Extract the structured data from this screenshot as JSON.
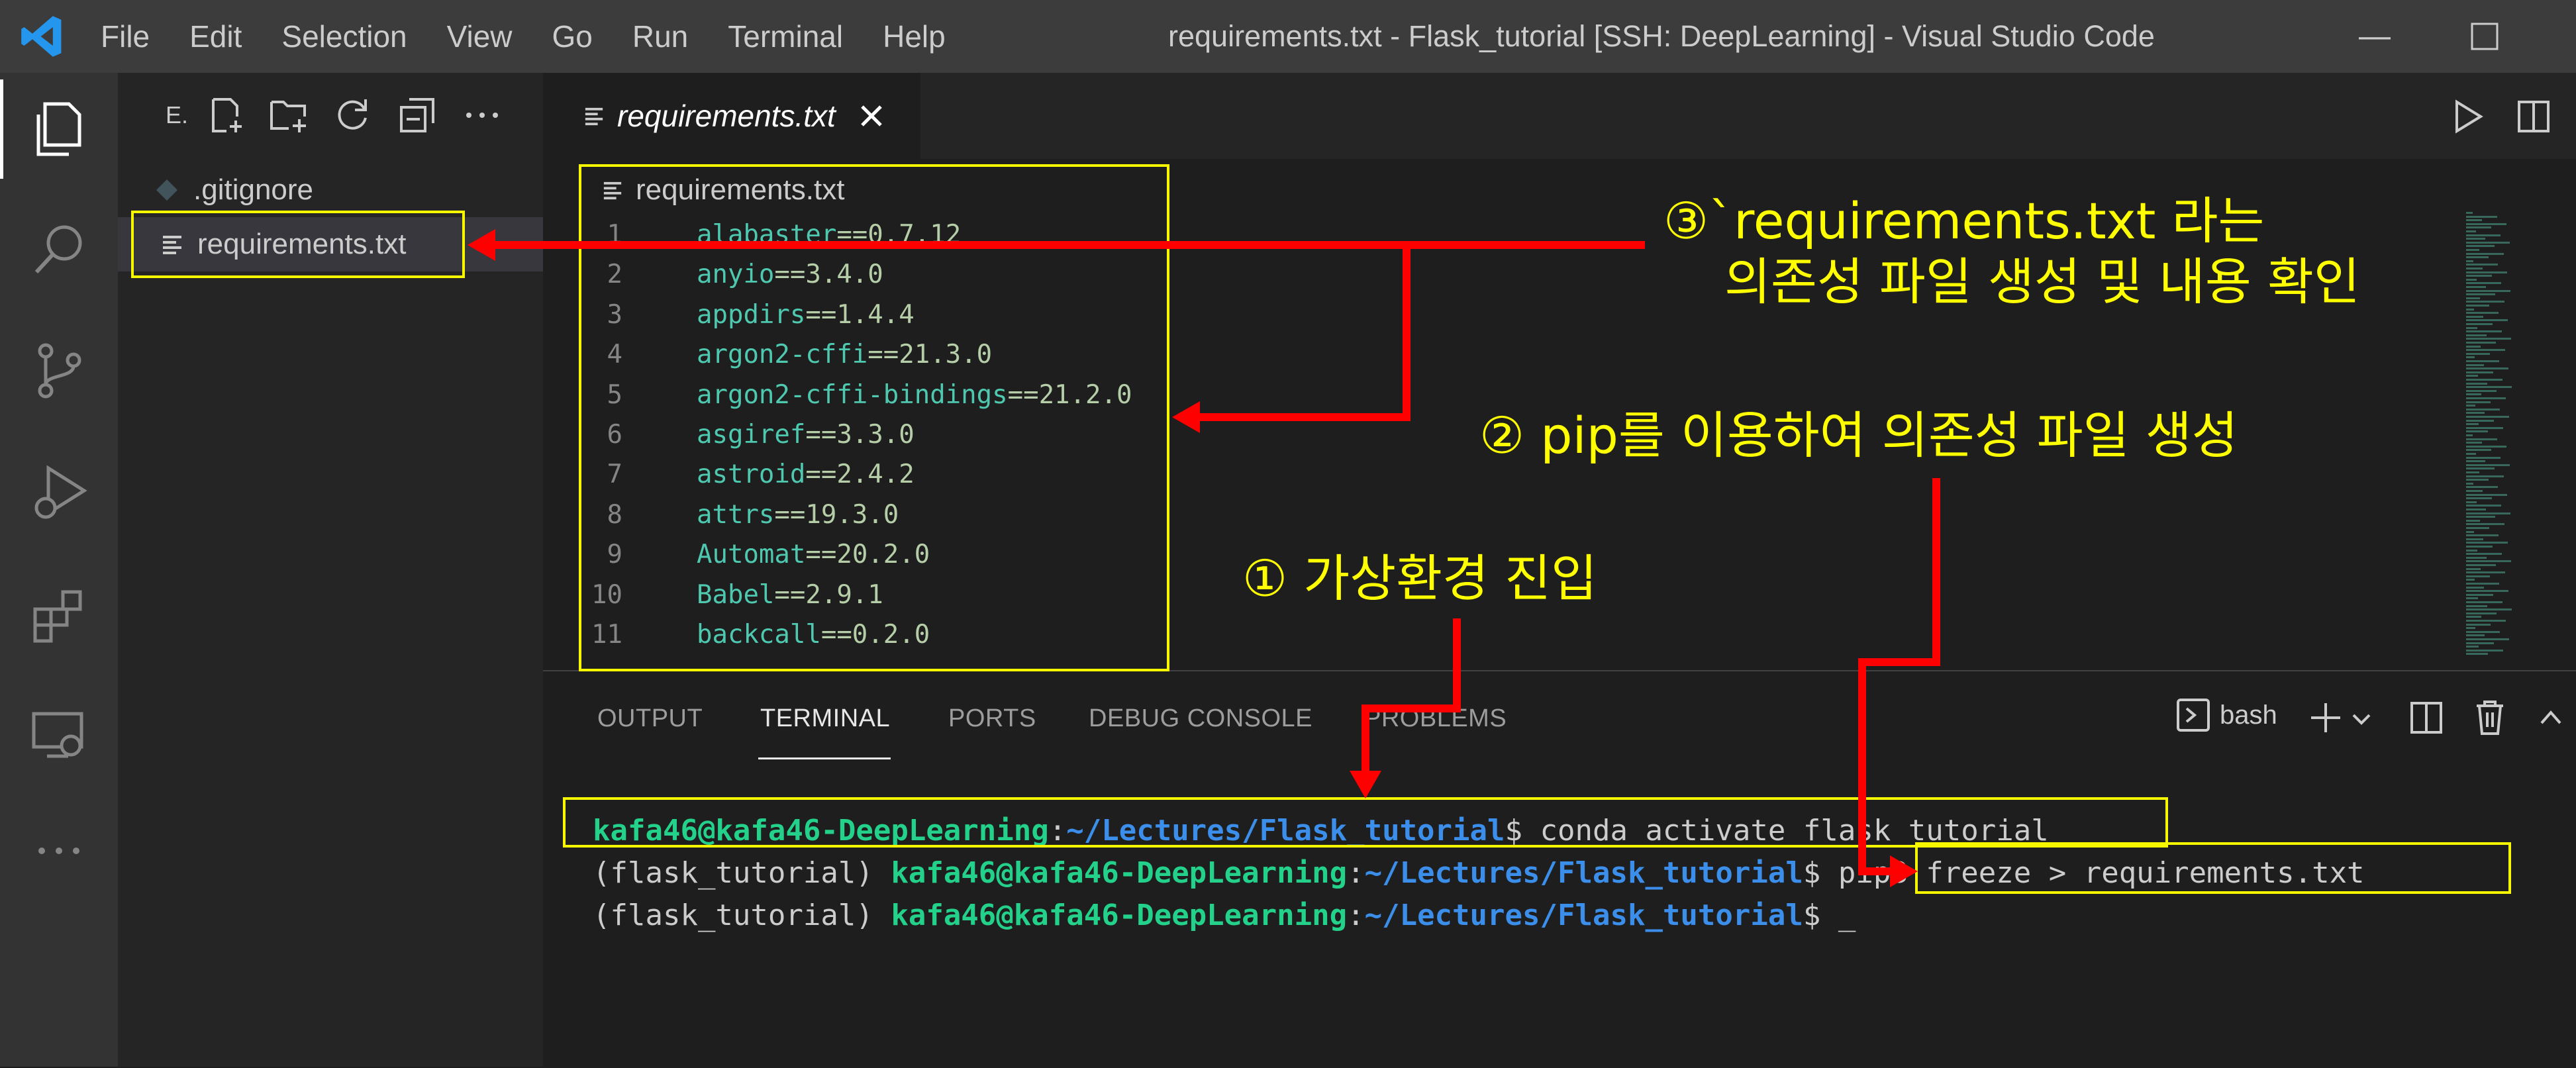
{
  "window": {
    "title": "requirements.txt - Flask_tutorial [SSH: DeepLearning] - Visual Studio Code",
    "menu": [
      "File",
      "Edit",
      "Selection",
      "View",
      "Go",
      "Run",
      "Terminal",
      "Help"
    ]
  },
  "activity_bar": {
    "icons": [
      "explorer-icon",
      "search-icon",
      "source-control-icon",
      "run-debug-icon",
      "extensions-icon",
      "remote-explorer-icon",
      "more-icon"
    ]
  },
  "sidebar": {
    "header": "E.",
    "toolbar_icons": [
      "new-file-icon",
      "new-folder-icon",
      "refresh-icon",
      "collapse-all-icon",
      "more-icon"
    ],
    "files": [
      {
        "name": ".gitignore",
        "icon": "gitignore-icon"
      },
      {
        "name": "requirements.txt",
        "icon": "text-file-icon",
        "selected": true
      }
    ]
  },
  "editor": {
    "tab_label": "requirements.txt",
    "breadcrumb": "requirements.txt",
    "lines": [
      {
        "n": "1",
        "pkg": "alabaster",
        "ver": "==0.7.12"
      },
      {
        "n": "2",
        "pkg": "anyio",
        "ver": "==3.4.0"
      },
      {
        "n": "3",
        "pkg": "appdirs",
        "ver": "==1.4.4"
      },
      {
        "n": "4",
        "pkg": "argon2-cffi",
        "ver": "==21.3.0"
      },
      {
        "n": "5",
        "pkg": "argon2-cffi-bindings",
        "ver": "==21.2.0"
      },
      {
        "n": "6",
        "pkg": "asgiref",
        "ver": "==3.3.0"
      },
      {
        "n": "7",
        "pkg": "astroid",
        "ver": "==2.4.2"
      },
      {
        "n": "8",
        "pkg": "attrs",
        "ver": "==19.3.0"
      },
      {
        "n": "9",
        "pkg": "Automat",
        "ver": "==20.2.0"
      },
      {
        "n": "10",
        "pkg": "Babel",
        "ver": "==2.9.1"
      },
      {
        "n": "11",
        "pkg": "backcall",
        "ver": "==0.2.0"
      }
    ]
  },
  "panel": {
    "tabs": [
      "OUTPUT",
      "TERMINAL",
      "PORTS",
      "DEBUG CONSOLE",
      "PROBLEMS"
    ],
    "active_tab": "TERMINAL",
    "shell": "bash",
    "terminal_lines": [
      {
        "env": "",
        "user": "kafa46@kafa46-DeepLearning",
        "path": "~/Lectures/Flask_tutorial",
        "cmd": "conda activate flask_tutorial"
      },
      {
        "env": "(flask_tutorial) ",
        "user": "kafa46@kafa46-DeepLearning",
        "path": "~/Lectures/Flask_tutorial",
        "cmd": "pip3 freeze > requirements.txt"
      },
      {
        "env": "(flask_tutorial) ",
        "user": "kafa46@kafa46-DeepLearning",
        "path": "~/Lectures/Flask_tutorial",
        "cmd": "_"
      }
    ]
  },
  "annotations": {
    "step1": "① 가상환경 진입",
    "step2": "② pip를 이용하여 의존성 파일 생성",
    "step3_line1": "③`requirements.txt 라는",
    "step3_line2": "의존성 파일 생성 및 내용 확인"
  },
  "colors": {
    "annotation_text": "#ffff00",
    "annotation_box": "#f7f700",
    "arrow": "#ff0000",
    "terminal_user": "#23d18b",
    "terminal_path": "#3b8eea"
  }
}
